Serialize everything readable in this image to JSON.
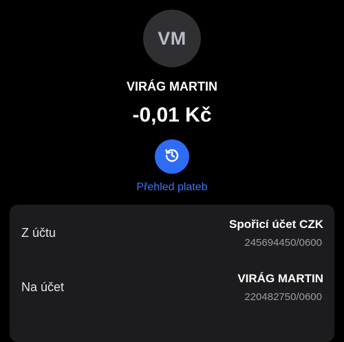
{
  "header": {
    "avatar_initials": "VM",
    "recipient_name": "VIRÁG MARTIN",
    "amount": "-0,01 Kč"
  },
  "history_action": {
    "icon": "history-icon",
    "label": "Přehled plateb",
    "color": "#2f6cf5"
  },
  "details": {
    "from": {
      "label": "Z účtu",
      "account_name": "Spořicí účet CZK",
      "account_number": "245694450/0600"
    },
    "to": {
      "label": "Na účet",
      "account_name": "VIRÁG MARTIN",
      "account_number": "220482750/0600"
    }
  }
}
